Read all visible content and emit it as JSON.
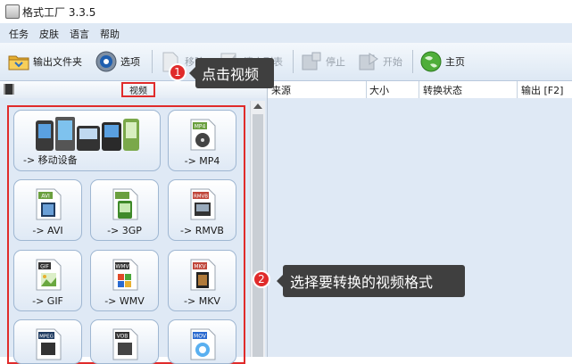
{
  "window": {
    "title": "格式工厂 3.3.5"
  },
  "menu": {
    "items": [
      "任务",
      "皮肤",
      "语言",
      "帮助"
    ]
  },
  "toolbar": {
    "output_folder": "输出文件夹",
    "options": "选项",
    "remove": "移除",
    "clear_list": "清空列表",
    "stop": "停止",
    "start": "开始",
    "home": "主页"
  },
  "left": {
    "tab_label": "视频"
  },
  "formats": [
    {
      "label": "-> 移动设备",
      "icon": "mobile-devices-icon"
    },
    {
      "label": "-> MP4",
      "icon": "mp4-file-icon",
      "tag": "MP4"
    },
    {
      "label": "-> AVI",
      "icon": "avi-file-icon",
      "tag": "AVI"
    },
    {
      "label": "-> 3GP",
      "icon": "3gp-file-icon",
      "tag": "3GP"
    },
    {
      "label": "-> RMVB",
      "icon": "rmvb-file-icon",
      "tag": "RMVB"
    },
    {
      "label": "-> GIF",
      "icon": "gif-file-icon",
      "tag": "GIF"
    },
    {
      "label": "-> WMV",
      "icon": "wmv-file-icon",
      "tag": "WMV"
    },
    {
      "label": "-> MKV",
      "icon": "mkv-file-icon",
      "tag": "MKV"
    },
    {
      "label": "",
      "icon": "mpeg-file-icon",
      "tag": "MPEG"
    },
    {
      "label": "",
      "icon": "vob-file-icon",
      "tag": "VOB"
    },
    {
      "label": "",
      "icon": "mov-file-icon",
      "tag": "MOV"
    }
  ],
  "columns": [
    "来源",
    "大小",
    "转换状态",
    "输出 [F2]"
  ],
  "callouts": [
    {
      "number": "1",
      "text": "点击视频"
    },
    {
      "number": "2",
      "text": "选择要转换的视频格式"
    }
  ],
  "colors": {
    "menubar": "#dfe9f5",
    "highlight": "#e02b2b",
    "callout": "#3f3f3f",
    "panel": "#dfe9f5"
  }
}
